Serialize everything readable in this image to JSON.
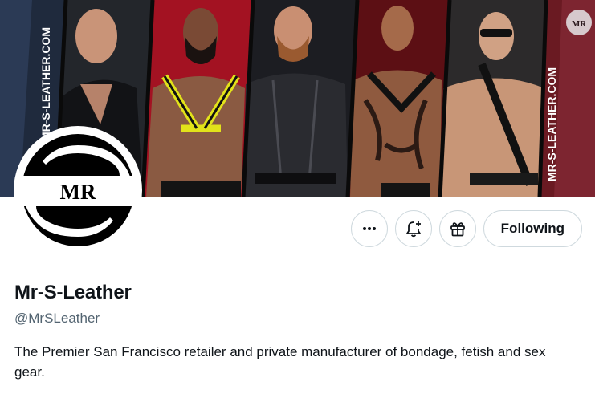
{
  "banner": {
    "watermark_left": "MR-S-LEATHER.COM",
    "watermark_right": "MR-S-LEATHER.COM",
    "mini_logo": "MR"
  },
  "avatar": {
    "logo_text": "MR"
  },
  "actions": {
    "more_icon": "ellipsis-icon",
    "notify_icon": "bell-plus-icon",
    "gift_icon": "gift-icon",
    "follow_label": "Following"
  },
  "profile": {
    "display_name": "Mr-S-Leather",
    "handle": "@MrSLeather",
    "bio": "The Premier San Francisco retailer and private manufacturer of bondage, fetish and sex gear."
  },
  "colors": {
    "text_primary": "#0f1419",
    "text_secondary": "#536471",
    "border": "#cfd9de",
    "harness_yellow": "#e2e21a"
  }
}
